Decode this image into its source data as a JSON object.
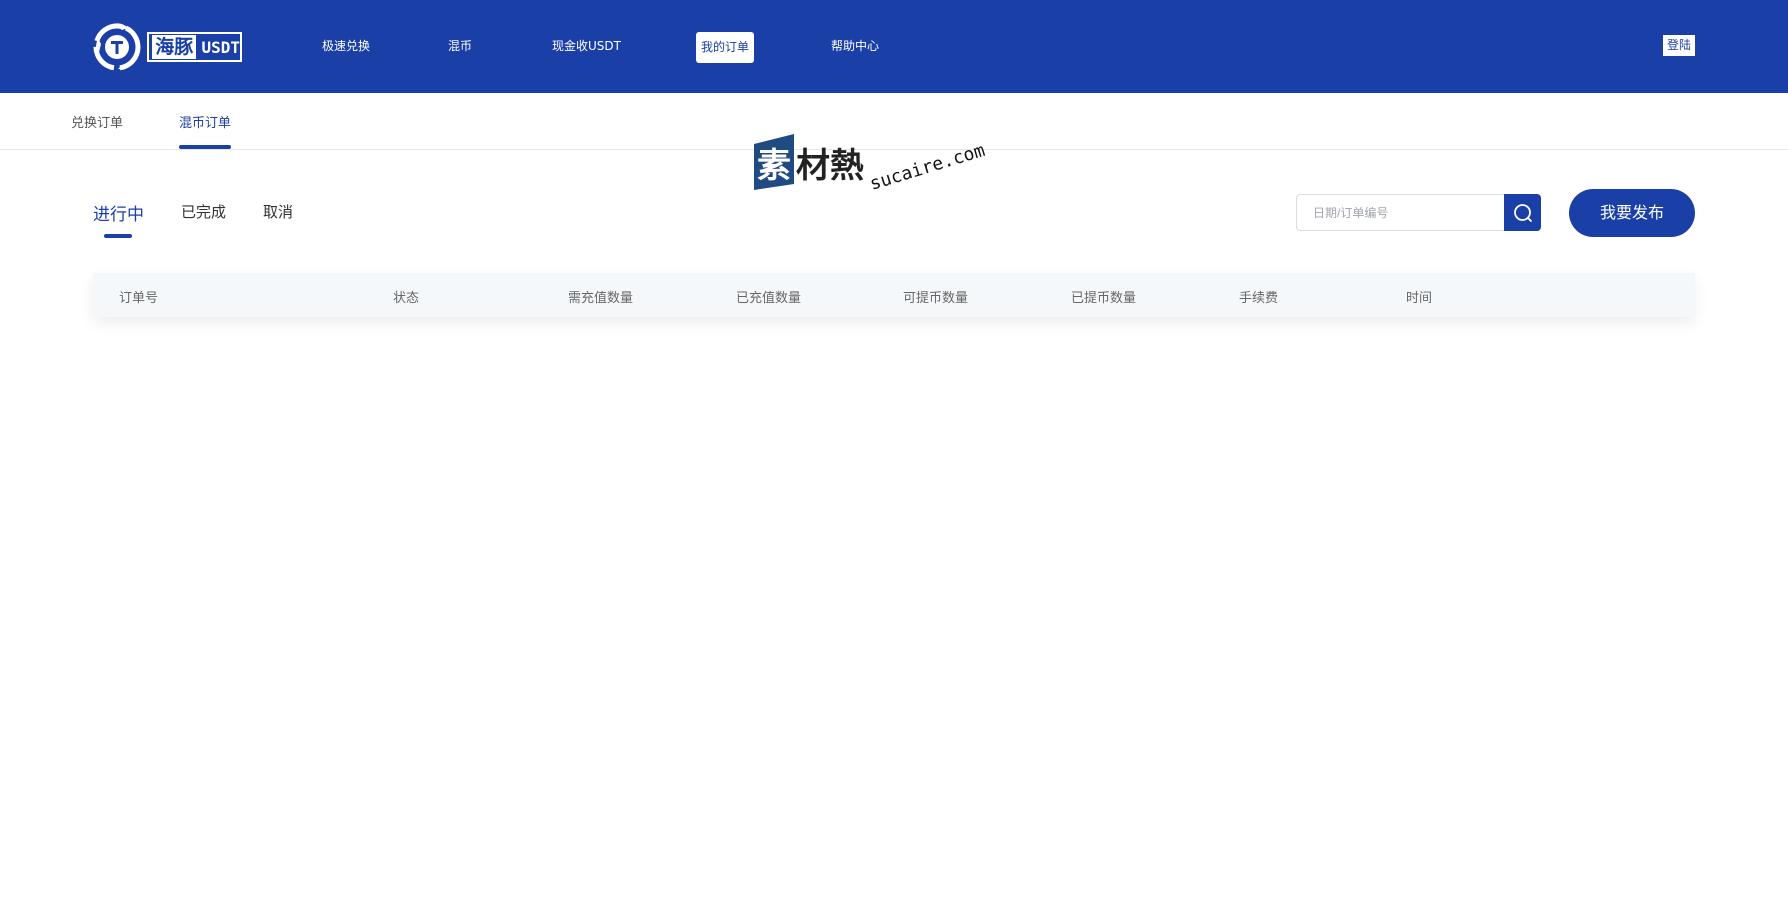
{
  "brand": {
    "logo_cn": "海豚",
    "logo_en": "USDT",
    "primary_color": "#1a3fa7"
  },
  "nav": {
    "items": [
      {
        "label": "极速兑换"
      },
      {
        "label": "混币"
      },
      {
        "label": "现金收USDT"
      },
      {
        "label": "我的订单",
        "active": true
      },
      {
        "label": "帮助中心"
      }
    ],
    "login_label": "登陆"
  },
  "subtabs": [
    {
      "label": "兑换订单"
    },
    {
      "label": "混币订单",
      "active": true
    }
  ],
  "watermark": {
    "cn": "素材熱",
    "en": "sucaire.com"
  },
  "status_tabs": [
    {
      "label": "进行中",
      "active": true
    },
    {
      "label": "已完成"
    },
    {
      "label": "取消"
    }
  ],
  "search": {
    "placeholder": "日期/订单编号",
    "icon": "search-icon"
  },
  "publish_label": "我要发布",
  "table": {
    "columns": [
      "订单号",
      "状态",
      "需充值数量",
      "已充值数量",
      "可提币数量",
      "已提币数量",
      "手续费",
      "时间"
    ],
    "rows": []
  }
}
